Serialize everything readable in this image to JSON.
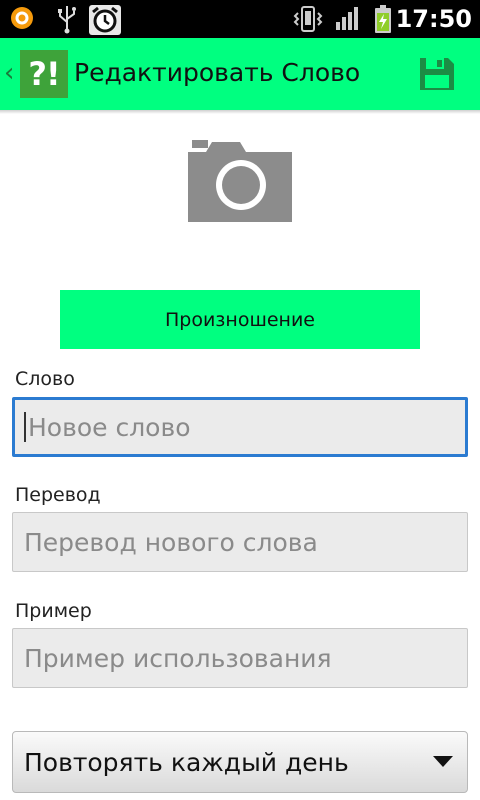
{
  "status_bar": {
    "time": "17:50",
    "icons": [
      "app-notification-icon",
      "usb-icon",
      "alarm-clock-icon",
      "vibrate-icon",
      "signal-icon",
      "battery-charging-icon"
    ]
  },
  "action_bar": {
    "logo_text": "?!",
    "title": "Редактировать Слово",
    "save_icon": "floppy-disk-icon"
  },
  "photo": {
    "icon": "camera-icon"
  },
  "pronunciation_button": {
    "label": "Произношение"
  },
  "form": {
    "word": {
      "label": "Слово",
      "placeholder": "Новое слово"
    },
    "translation": {
      "label": "Перевод",
      "placeholder": "Перевод нового слова"
    },
    "example": {
      "label": "Пример",
      "placeholder": "Пример использования"
    }
  },
  "repeat_spinner": {
    "selected": "Повторять каждый день"
  },
  "colors": {
    "accent": "#00ff80",
    "focus": "#2b7bd1",
    "logo": "#3ea33a"
  }
}
